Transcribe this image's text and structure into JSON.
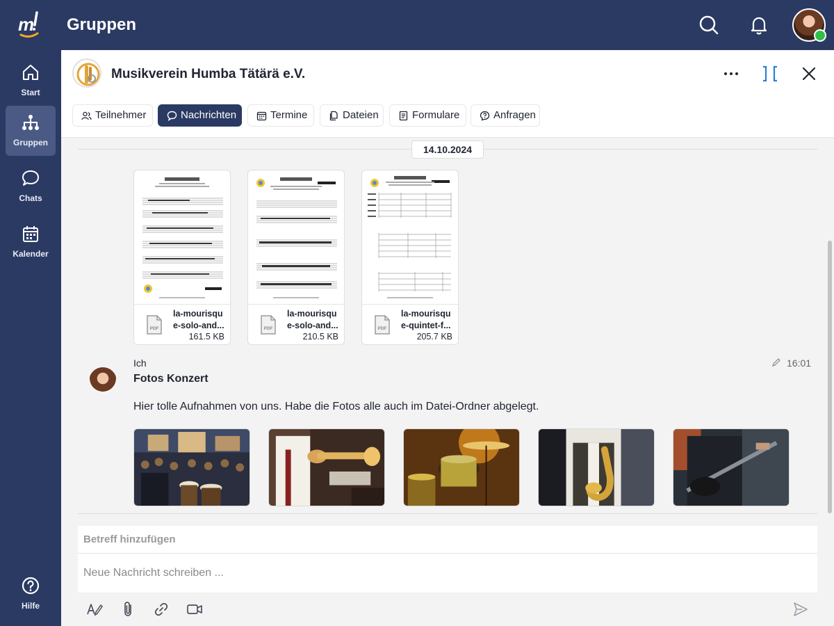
{
  "app": {
    "title": "Gruppen"
  },
  "sidebar": {
    "items": [
      {
        "label": "Start",
        "icon": "home-icon"
      },
      {
        "label": "Gruppen",
        "icon": "groups-icon",
        "active": true
      },
      {
        "label": "Chats",
        "icon": "chat-icon"
      },
      {
        "label": "Kalender",
        "icon": "calendar-icon"
      }
    ],
    "help_label": "Hilfe"
  },
  "group": {
    "name": "Musikverein Humba Tätärä e.V."
  },
  "tabs": [
    {
      "label": "Teilnehmer",
      "icon": "people-icon"
    },
    {
      "label": "Nachrichten",
      "icon": "message-icon",
      "active": true
    },
    {
      "label": "Termine",
      "icon": "calendar-icon"
    },
    {
      "label": "Dateien",
      "icon": "files-icon"
    },
    {
      "label": "Formulare",
      "icon": "form-icon"
    },
    {
      "label": "Anfragen",
      "icon": "question-icon"
    }
  ],
  "messages": {
    "date": "14.10.2024",
    "files": [
      {
        "name": "la-mourisque-solo-and...",
        "line1": "la-mourisqu",
        "line2": "e-solo-and...",
        "size": "161.5 KB",
        "type": "PDF"
      },
      {
        "name": "la-mourisque-solo-and...",
        "line1": "la-mourisqu",
        "line2": "e-solo-and...",
        "size": "210.5 KB",
        "type": "PDF"
      },
      {
        "name": "la-mourisque-quintet-f...",
        "line1": "la-mourisqu",
        "line2": "e-quintet-f...",
        "size": "205.7 KB",
        "type": "PDF"
      }
    ],
    "message": {
      "author": "Ich",
      "time": "16:01",
      "subject": "Fotos Konzert",
      "text": "Hier tolle Aufnahmen von uns. Habe die Fotos alle auch im Datei-Ordner abgelegt."
    }
  },
  "composer": {
    "subject_placeholder": "Betreff hinzufügen",
    "message_placeholder": "Neue Nachricht schreiben ..."
  },
  "colors": {
    "brand": "#2b3a63",
    "accent": "#f4a623",
    "online": "#2fbf4a",
    "link": "#2a7fd4"
  }
}
